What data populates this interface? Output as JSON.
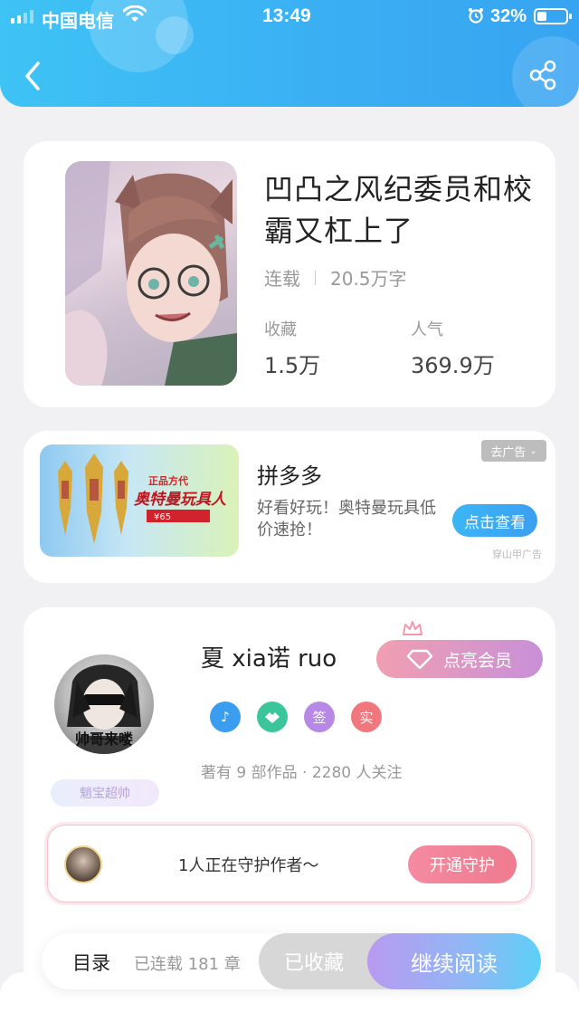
{
  "status_bar": {
    "carrier": "中国电信",
    "time": "13:49",
    "battery": "32%",
    "battery_level": 0.32
  },
  "nav": {
    "back_icon": "chevron-left-icon",
    "share_icon": "share-icon"
  },
  "book": {
    "title": "凹凸之风纪委员和校霸又杠上了",
    "status": "连载",
    "word_count": "20.5万字",
    "stats": [
      {
        "label": "收藏",
        "value": "1.5万"
      },
      {
        "label": "人气",
        "value": "369.9万"
      }
    ]
  },
  "ad": {
    "close_label": "去广告",
    "brand": "拼多多",
    "description": "好看好玩！奥特曼玩具低价速抢！",
    "cta": "点击查看",
    "source": "穿山甲广告",
    "image_caption": "奥特曼玩具人",
    "image_tag": "正品方代",
    "image_price": "¥65"
  },
  "author": {
    "name": "夏 xia诺 ruo",
    "avatar_caption": "帅哥来喽",
    "fan_badge": "魈宝超帅",
    "vip_button": "点亮会员",
    "badges": [
      {
        "icon": "music-note-icon",
        "text": "♪",
        "color": "#3b9df0"
      },
      {
        "icon": "handshake-icon",
        "text": "",
        "color": "#3cc49a"
      },
      {
        "icon": "sign-icon",
        "text": "签",
        "color": "#b788e6"
      },
      {
        "icon": "verified-icon",
        "text": "实",
        "color": "#f1777f"
      }
    ],
    "stats_line": "著有 9 部作品 · 2280 人关注",
    "guard_text": "1人正在守护作者～",
    "guard_button": "开通守护"
  },
  "bottom_bar": {
    "toc": "目录",
    "chapters": "已连载 181 章",
    "collected": "已收藏",
    "read": "继续阅读"
  },
  "colors": {
    "header": "#3aaef3",
    "accent_blue": "#3b9ff2",
    "vip_pink": "#f19fb1",
    "guard_pink": "#f58aa1"
  }
}
